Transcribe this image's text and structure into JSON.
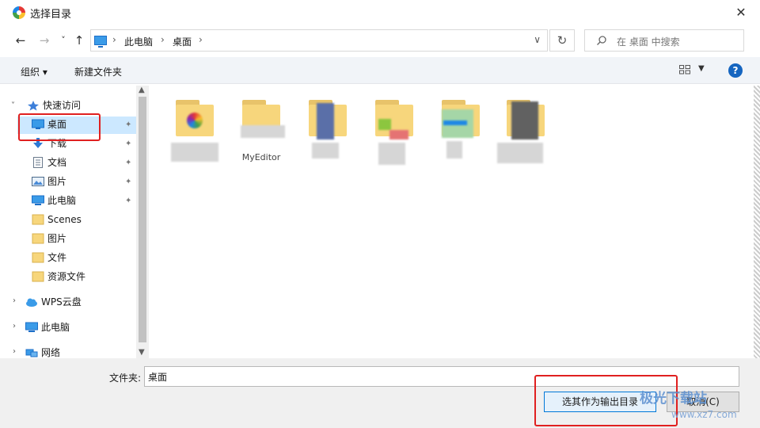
{
  "window": {
    "title": "选择目录",
    "close_glyph": "✕"
  },
  "nav": {
    "back_glyph": "←",
    "forward_glyph": "→",
    "recent_glyph": "˅",
    "up_glyph": "↑"
  },
  "address": {
    "sep": "›",
    "crumbs": [
      "此电脑",
      "桌面"
    ],
    "dropdown_glyph": "∨",
    "refresh_glyph": "↻"
  },
  "search": {
    "placeholder": "在 桌面 中搜索"
  },
  "toolbar": {
    "organize": "组织 ▾",
    "new_folder": "新建文件夹",
    "view_dropdown": "▼",
    "help": "?"
  },
  "sidebar": {
    "quick_access": "快速访问",
    "items": [
      {
        "label": "桌面",
        "pinned": true
      },
      {
        "label": "下载",
        "pinned": true
      },
      {
        "label": "文档",
        "pinned": true
      },
      {
        "label": "图片",
        "pinned": true
      },
      {
        "label": "此电脑",
        "pinned": true
      },
      {
        "label": "Scenes",
        "pinned": false
      },
      {
        "label": "图片",
        "pinned": false
      },
      {
        "label": "文件",
        "pinned": false
      },
      {
        "label": "资源文件",
        "pinned": false
      }
    ],
    "roots": [
      "WPS云盘",
      "此电脑",
      "网络"
    ],
    "pin_glyph": "📌",
    "expand_glyph": "›",
    "collapse_glyph": "˅"
  },
  "files": [
    {
      "name": ""
    },
    {
      "name": "MyEditor"
    },
    {
      "name": ""
    },
    {
      "name": ""
    },
    {
      "name": ""
    },
    {
      "name": ""
    }
  ],
  "bottom": {
    "folder_label": "文件夹:",
    "folder_value": "桌面",
    "ok_label": "选其作为输出目录",
    "cancel_label": "取消(C)"
  },
  "watermark": {
    "brand": "极光下载站",
    "url": "www.xz7.com"
  },
  "colors": {
    "accent": "#0078d7",
    "selection": "#cce8ff",
    "highlight": "#e02020",
    "folder": "#f7d67c"
  }
}
